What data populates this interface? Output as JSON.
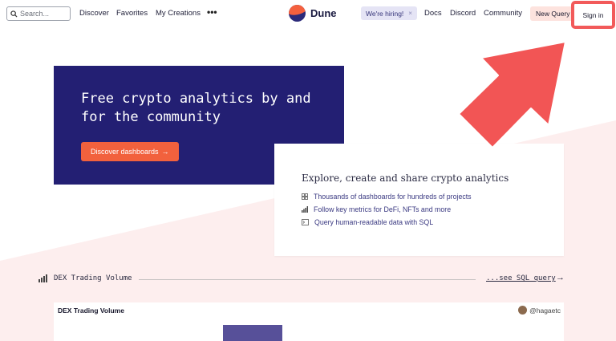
{
  "nav": {
    "search_placeholder": "Search...",
    "links": [
      "Discover",
      "Favorites",
      "My Creations"
    ],
    "more": "•••",
    "brand": "Dune",
    "hiring": "We're hiring!",
    "hiring_close": "×",
    "right_links": [
      "Docs",
      "Discord",
      "Community"
    ],
    "new_query": "New Query",
    "sign_in": "Sign in"
  },
  "hero": {
    "title": "Free crypto analytics by and for the community",
    "button": "Discover dashboards",
    "button_arrow": "→"
  },
  "info": {
    "title": "Explore, create and share crypto analytics",
    "items": [
      "Thousands of dashboards for hundreds of projects",
      "Follow key metrics for DeFi, NFTs and more",
      "Query human-readable data with SQL"
    ]
  },
  "dex": {
    "section_label": "DEX Trading Volume",
    "sql_link": "...see SQL query",
    "sql_arrow": "→",
    "card_title": "DEX Trading Volume",
    "author": "@hagaetc"
  },
  "colors": {
    "hero_bg": "#231f73",
    "accent": "#f2613d",
    "highlight": "#f25a5a",
    "pink_bg": "#fdeeee"
  }
}
